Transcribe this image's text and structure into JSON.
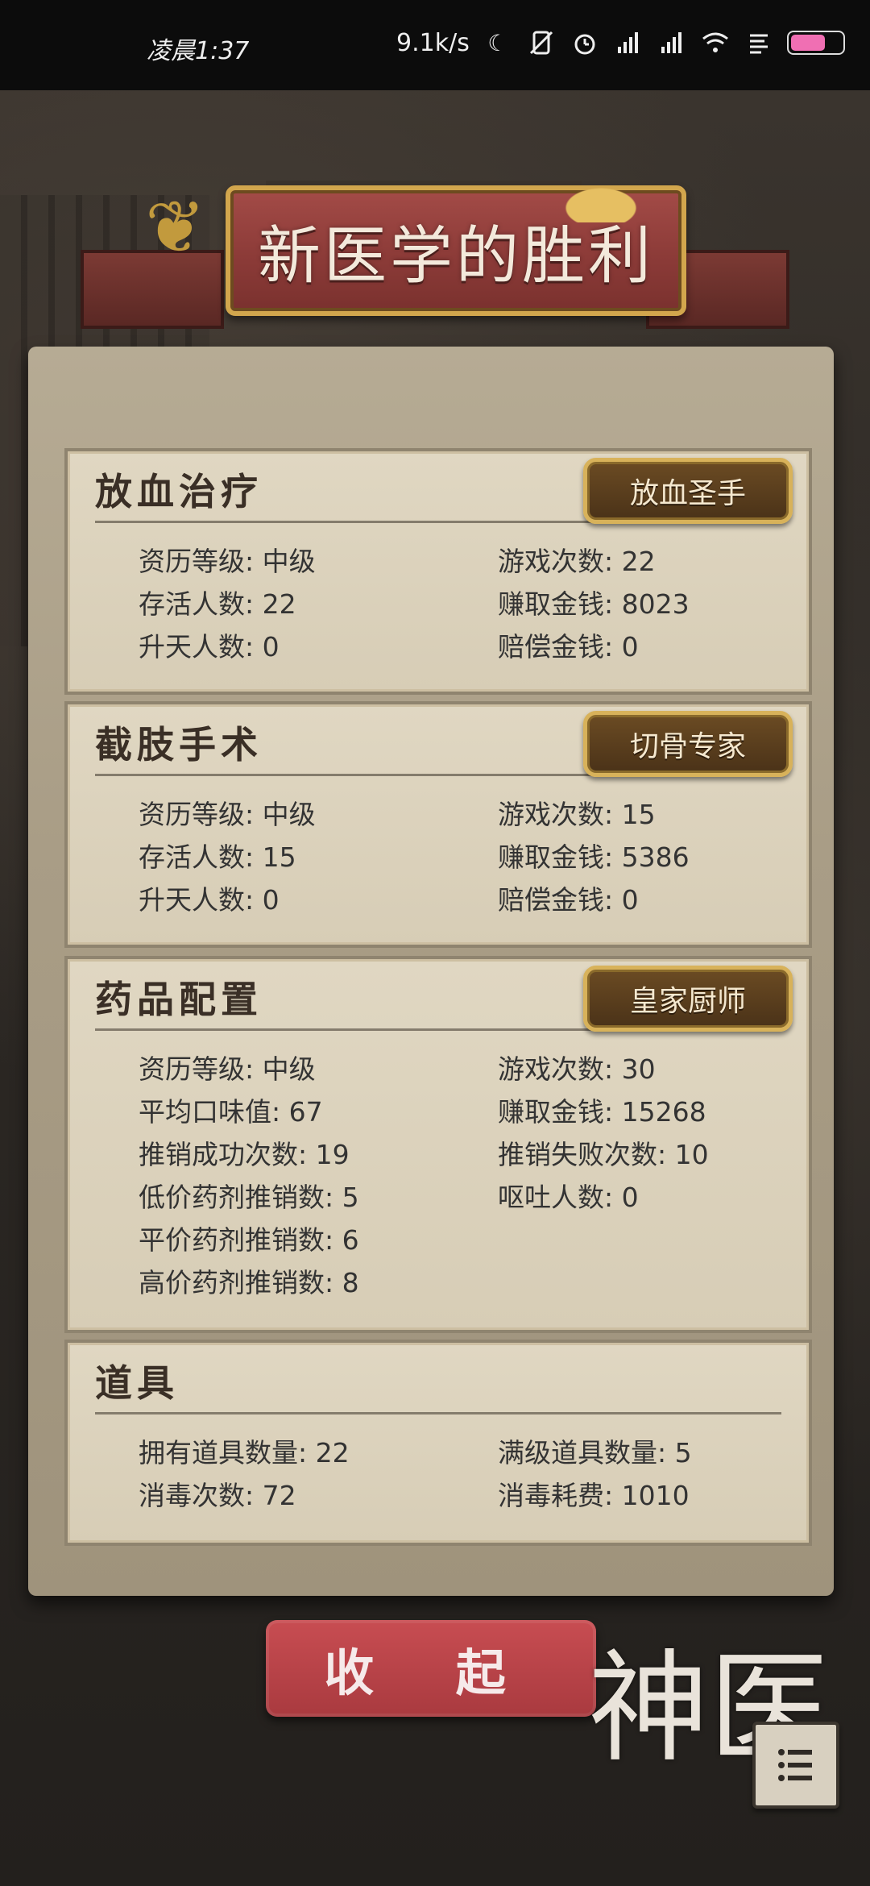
{
  "status_bar": {
    "time": "凌晨1:37",
    "net_speed": "9.1k/s"
  },
  "banner": {
    "title": "新医学的胜利"
  },
  "sections": [
    {
      "title": "放血治疗",
      "badge": "放血圣手",
      "stats": [
        {
          "label": "资历等级",
          "value": "中级"
        },
        {
          "label": "游戏次数",
          "value": "22"
        },
        {
          "label": "存活人数",
          "value": "22"
        },
        {
          "label": "赚取金钱",
          "value": "8023"
        },
        {
          "label": "升天人数",
          "value": "0"
        },
        {
          "label": "赔偿金钱",
          "value": "0"
        }
      ]
    },
    {
      "title": "截肢手术",
      "badge": "切骨专家",
      "stats": [
        {
          "label": "资历等级",
          "value": "中级"
        },
        {
          "label": "游戏次数",
          "value": "15"
        },
        {
          "label": "存活人数",
          "value": "15"
        },
        {
          "label": "赚取金钱",
          "value": "5386"
        },
        {
          "label": "升天人数",
          "value": "0"
        },
        {
          "label": "赔偿金钱",
          "value": "0"
        }
      ]
    },
    {
      "title": "药品配置",
      "badge": "皇家厨师",
      "stats": [
        {
          "label": "资历等级",
          "value": "中级"
        },
        {
          "label": "游戏次数",
          "value": "30"
        },
        {
          "label": "平均口味值",
          "value": "67"
        },
        {
          "label": "赚取金钱",
          "value": "15268"
        },
        {
          "label": "推销成功次数",
          "value": "19"
        },
        {
          "label": "推销失败次数",
          "value": "10"
        },
        {
          "label": "低价药剂推销数",
          "value": "5"
        },
        {
          "label": "呕吐人数",
          "value": "0"
        },
        {
          "label": "平价药剂推销数",
          "value": "6"
        },
        {
          "label": "高价药剂推销数",
          "value": "8"
        }
      ]
    },
    {
      "title": "道具",
      "stats": [
        {
          "label": "拥有道具数量",
          "value": "22"
        },
        {
          "label": "满级道具数量",
          "value": "5"
        },
        {
          "label": "消毒次数",
          "value": "72"
        },
        {
          "label": "消毒耗费",
          "value": "1010"
        }
      ]
    }
  ],
  "collapse_button": "收 起",
  "logo_text": "神医",
  "colors": {
    "banner": "#8c3b38",
    "badge_border": "#d8b25a",
    "button": "#b9444a",
    "parchment": "#d7cdb6"
  }
}
